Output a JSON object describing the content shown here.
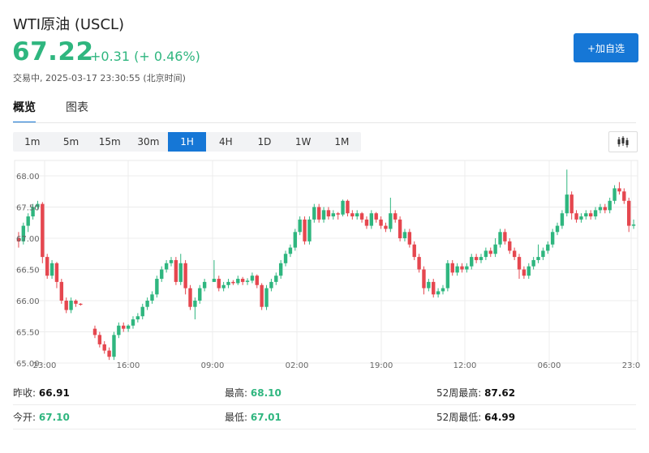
{
  "header": {
    "title": "WTI原油 (USCL)",
    "price": "67.22",
    "change": "+0.31 (+ 0.46%)",
    "status": "交易中,  2025-03-17 23:30:55 (北京时间)"
  },
  "buttons": {
    "add_watchlist": "+加自选"
  },
  "tabs": [
    {
      "label": "概览"
    },
    {
      "label": "图表"
    }
  ],
  "intervals": [
    "1m",
    "5m",
    "15m",
    "30m",
    "1H",
    "4H",
    "1D",
    "1W",
    "1M"
  ],
  "active_interval": "1H",
  "colors": {
    "up": "#2fb67f",
    "down": "#e5474f",
    "accent": "#1677d6"
  },
  "stats": {
    "prev_close_label": "昨收:",
    "prev_close": "66.91",
    "high_label": "最高:",
    "high": "68.10",
    "w52_high_label": "52周最高:",
    "w52_high": "87.62",
    "open_label": "今开:",
    "open": "67.10",
    "low_label": "最低:",
    "low": "67.01",
    "w52_low_label": "52周最低:",
    "w52_low": "64.99"
  },
  "chart_data": {
    "type": "candlestick",
    "ylim": [
      65.0,
      68.1
    ],
    "y_ticks": [
      "68.00",
      "67.50",
      "67.00",
      "66.50",
      "66.00",
      "65.50",
      "65.00"
    ],
    "x_ticks": [
      "23:00",
      "16:00",
      "09:00",
      "02:00",
      "19:00",
      "12:00",
      "06:00",
      "23:0"
    ],
    "grid": true,
    "candles": [
      [
        67.0,
        66.95,
        67.1,
        66.85
      ],
      [
        66.95,
        67.2,
        67.25,
        66.9
      ],
      [
        67.2,
        67.35,
        67.4,
        67.1
      ],
      [
        67.35,
        67.5,
        67.55,
        67.3
      ],
      [
        67.5,
        67.55,
        67.6,
        67.45
      ],
      [
        67.55,
        66.7,
        67.58,
        66.6
      ],
      [
        66.7,
        66.4,
        66.75,
        66.35
      ],
      [
        66.4,
        66.6,
        66.65,
        66.35
      ],
      [
        66.6,
        66.3,
        66.62,
        66.2
      ],
      [
        66.3,
        66.0,
        66.35,
        65.95
      ],
      [
        66.0,
        65.85,
        66.05,
        65.8
      ],
      [
        65.85,
        66.0,
        66.05,
        65.8
      ],
      [
        66.0,
        65.95,
        66.02,
        65.9
      ],
      [
        65.95,
        65.94,
        65.96,
        65.92
      ],
      [
        null,
        null,
        null,
        null
      ],
      [
        null,
        null,
        null,
        null
      ],
      [
        65.55,
        65.45,
        65.6,
        65.4
      ],
      [
        65.45,
        65.3,
        65.5,
        65.25
      ],
      [
        65.3,
        65.2,
        65.35,
        65.15
      ],
      [
        65.2,
        65.1,
        65.25,
        65.05
      ],
      [
        65.1,
        65.45,
        65.5,
        65.05
      ],
      [
        65.45,
        65.6,
        65.65,
        65.4
      ],
      [
        65.6,
        65.55,
        65.65,
        65.5
      ],
      [
        65.55,
        65.6,
        65.62,
        65.5
      ],
      [
        65.6,
        65.7,
        65.75,
        65.55
      ],
      [
        65.7,
        65.75,
        65.8,
        65.65
      ],
      [
        65.75,
        65.9,
        65.95,
        65.7
      ],
      [
        65.9,
        66.0,
        66.05,
        65.85
      ],
      [
        66.0,
        66.1,
        66.15,
        65.95
      ],
      [
        66.1,
        66.35,
        66.4,
        66.05
      ],
      [
        66.35,
        66.5,
        66.55,
        66.3
      ],
      [
        66.5,
        66.6,
        66.65,
        66.45
      ],
      [
        66.6,
        66.65,
        66.7,
        66.55
      ],
      [
        66.65,
        66.3,
        66.7,
        66.25
      ],
      [
        66.3,
        66.6,
        66.75,
        66.25
      ],
      [
        66.6,
        66.2,
        66.65,
        66.1
      ],
      [
        66.2,
        65.9,
        66.25,
        65.85
      ],
      [
        65.9,
        66.0,
        66.05,
        65.7
      ],
      [
        66.0,
        66.2,
        66.25,
        65.95
      ],
      [
        66.2,
        66.3,
        66.35,
        66.15
      ],
      [
        null,
        null,
        null,
        null
      ],
      [
        66.3,
        66.35,
        66.65,
        66.3
      ],
      [
        66.35,
        66.2,
        66.4,
        66.15
      ],
      [
        66.2,
        66.25,
        66.3,
        66.15
      ],
      [
        66.25,
        66.3,
        66.35,
        66.2
      ],
      [
        66.3,
        66.28,
        66.33,
        66.25
      ],
      [
        66.28,
        66.35,
        66.4,
        66.25
      ],
      [
        66.35,
        66.3,
        66.38,
        66.25
      ],
      [
        66.3,
        66.32,
        66.36,
        66.25
      ],
      [
        66.32,
        66.4,
        66.45,
        66.28
      ],
      [
        66.4,
        66.25,
        66.42,
        66.2
      ],
      [
        66.25,
        65.9,
        66.28,
        65.85
      ],
      [
        65.9,
        66.2,
        66.25,
        65.85
      ],
      [
        66.2,
        66.3,
        66.35,
        66.15
      ],
      [
        66.3,
        66.4,
        66.45,
        66.25
      ],
      [
        66.4,
        66.6,
        66.65,
        66.35
      ],
      [
        66.6,
        66.75,
        66.8,
        66.55
      ],
      [
        66.75,
        66.85,
        66.9,
        66.7
      ],
      [
        66.85,
        67.1,
        67.15,
        66.8
      ],
      [
        67.1,
        67.3,
        67.35,
        67.05
      ],
      [
        67.3,
        66.95,
        67.35,
        66.9
      ],
      [
        66.95,
        67.3,
        67.35,
        66.9
      ],
      [
        67.3,
        67.5,
        67.55,
        67.25
      ],
      [
        67.5,
        67.3,
        67.55,
        67.25
      ],
      [
        67.3,
        67.45,
        67.5,
        67.25
      ],
      [
        67.45,
        67.35,
        67.5,
        67.3
      ],
      [
        67.35,
        67.4,
        67.45,
        67.3
      ],
      [
        67.4,
        67.38,
        67.42,
        67.3
      ],
      [
        67.38,
        67.6,
        67.62,
        67.35
      ],
      [
        67.6,
        67.4,
        67.62,
        67.35
      ],
      [
        67.4,
        67.35,
        67.45,
        67.3
      ],
      [
        67.35,
        67.4,
        67.45,
        67.3
      ],
      [
        67.4,
        67.3,
        67.42,
        67.25
      ],
      [
        67.3,
        67.2,
        67.35,
        67.15
      ],
      [
        67.2,
        67.4,
        67.45,
        67.15
      ],
      [
        67.4,
        67.3,
        67.42,
        67.25
      ],
      [
        67.3,
        67.2,
        67.35,
        67.15
      ],
      [
        67.2,
        67.15,
        67.25,
        67.1
      ],
      [
        67.15,
        67.4,
        67.65,
        67.1
      ],
      [
        67.4,
        67.3,
        67.45,
        67.25
      ],
      [
        67.3,
        67.0,
        67.35,
        66.95
      ],
      [
        67.0,
        67.1,
        67.15,
        66.95
      ],
      [
        67.1,
        66.9,
        67.15,
        66.85
      ],
      [
        66.9,
        66.7,
        66.95,
        66.65
      ],
      [
        66.7,
        66.5,
        66.75,
        66.45
      ],
      [
        66.5,
        66.2,
        66.55,
        66.1
      ],
      [
        66.2,
        66.3,
        66.35,
        66.15
      ],
      [
        66.3,
        66.1,
        66.35,
        66.05
      ],
      [
        66.1,
        66.15,
        66.2,
        66.05
      ],
      [
        66.15,
        66.2,
        66.25,
        66.1
      ],
      [
        66.2,
        66.6,
        66.65,
        66.15
      ],
      [
        66.6,
        66.45,
        66.65,
        66.4
      ],
      [
        66.45,
        66.55,
        66.6,
        66.4
      ],
      [
        66.55,
        66.5,
        66.6,
        66.45
      ],
      [
        66.5,
        66.55,
        66.6,
        66.45
      ],
      [
        66.55,
        66.7,
        66.75,
        66.5
      ],
      [
        66.7,
        66.65,
        66.75,
        66.6
      ],
      [
        66.65,
        66.7,
        66.75,
        66.6
      ],
      [
        66.7,
        66.8,
        66.85,
        66.65
      ],
      [
        66.8,
        66.75,
        66.85,
        66.7
      ],
      [
        66.75,
        66.9,
        67.0,
        66.7
      ],
      [
        66.9,
        67.1,
        67.15,
        66.85
      ],
      [
        67.1,
        66.95,
        67.15,
        66.9
      ],
      [
        66.95,
        66.8,
        67.0,
        66.75
      ],
      [
        66.8,
        66.7,
        66.85,
        66.65
      ],
      [
        66.7,
        66.5,
        66.75,
        66.35
      ],
      [
        66.5,
        66.4,
        66.55,
        66.35
      ],
      [
        66.4,
        66.55,
        66.6,
        66.35
      ],
      [
        66.55,
        66.65,
        66.7,
        66.5
      ],
      [
        66.65,
        66.7,
        66.9,
        66.6
      ],
      [
        66.7,
        66.8,
        66.85,
        66.65
      ],
      [
        66.8,
        66.9,
        66.95,
        66.75
      ],
      [
        66.9,
        67.1,
        67.15,
        66.85
      ],
      [
        67.1,
        67.2,
        67.25,
        67.05
      ],
      [
        67.2,
        67.4,
        67.45,
        67.15
      ],
      [
        67.4,
        67.7,
        68.1,
        67.35
      ],
      [
        67.7,
        67.4,
        67.75,
        67.3
      ],
      [
        67.4,
        67.3,
        67.45,
        67.25
      ],
      [
        67.3,
        67.35,
        67.4,
        67.25
      ],
      [
        67.35,
        67.4,
        67.45,
        67.3
      ],
      [
        67.4,
        67.35,
        67.45,
        67.3
      ],
      [
        67.35,
        67.45,
        67.5,
        67.3
      ],
      [
        67.45,
        67.5,
        67.55,
        67.4
      ],
      [
        67.5,
        67.45,
        67.55,
        67.4
      ],
      [
        67.45,
        67.6,
        67.65,
        67.4
      ],
      [
        67.6,
        67.8,
        67.85,
        67.55
      ],
      [
        67.8,
        67.75,
        67.9,
        67.7
      ],
      [
        67.75,
        67.6,
        67.8,
        67.55
      ],
      [
        67.6,
        67.2,
        67.65,
        67.1
      ],
      [
        67.2,
        67.22,
        67.3,
        67.15
      ]
    ]
  }
}
